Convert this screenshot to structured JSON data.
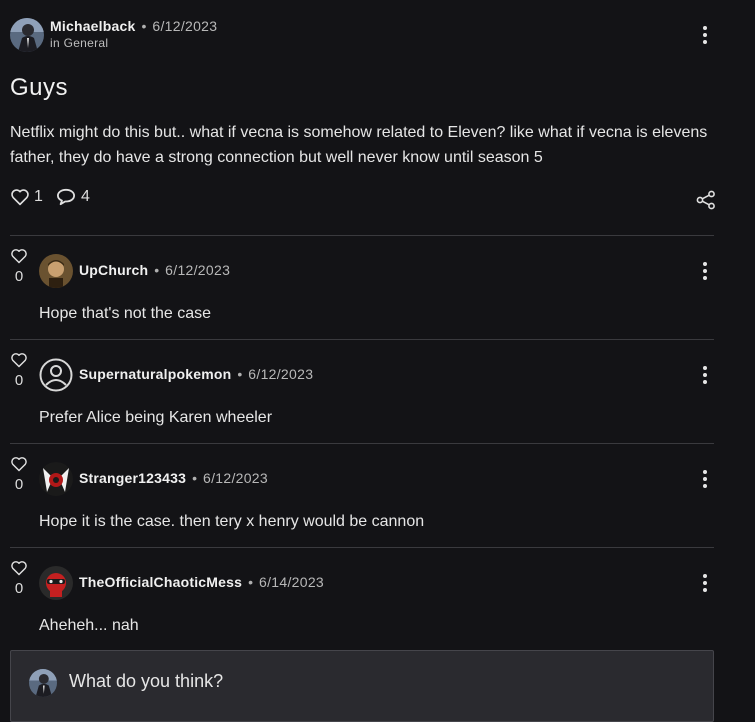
{
  "post": {
    "author": "Michaelback",
    "date": "6/12/2023",
    "category": "in General",
    "title": "Guys",
    "body": "Netflix might do this but.. what if vecna is somehow related to Eleven? like what if vecna is elevens father, they do have a strong connection but well never know until season 5",
    "likes": "1",
    "comments_count": "4",
    "icons": {
      "like": "heart-icon",
      "comment": "speech-bubble-icon",
      "share": "share-icon",
      "menu": "more-vertical-icon"
    }
  },
  "comments": [
    {
      "author": "UpChurch",
      "date": "6/12/2023",
      "text": "Hope that's not the case",
      "likes": "0"
    },
    {
      "author": "Supernaturalpokemon",
      "date": "6/12/2023",
      "text": "Prefer Alice being Karen wheeler",
      "likes": "0"
    },
    {
      "author": "Stranger123433",
      "date": "6/12/2023",
      "text": "Hope it is the case. then tery x henry would be cannon",
      "likes": "0"
    },
    {
      "author": "TheOfficialChaoticMess",
      "date": "6/14/2023",
      "text": "Aheheh... nah",
      "likes": "0"
    }
  ],
  "reply": {
    "placeholder": "What do you think?"
  },
  "colors": {
    "background": "#131316",
    "divider": "#3a3a3e",
    "reply_box": "#2a2a2f"
  }
}
